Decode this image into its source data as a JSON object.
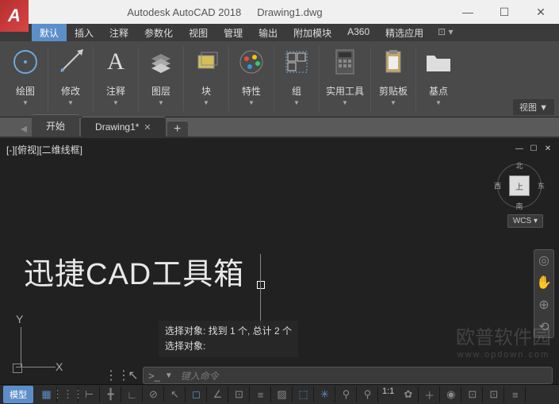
{
  "title": {
    "app": "Autodesk AutoCAD 2018",
    "file": "Drawing1.dwg"
  },
  "logo": "A",
  "win": {
    "min": "—",
    "max": "☐",
    "close": "✕"
  },
  "menu": [
    "默认",
    "插入",
    "注释",
    "参数化",
    "视图",
    "管理",
    "输出",
    "附加模块",
    "A360",
    "精选应用"
  ],
  "ribbon": [
    {
      "label": "绘图",
      "icon": "circle"
    },
    {
      "label": "修改",
      "icon": "move"
    },
    {
      "label": "注释",
      "icon": "text"
    },
    {
      "label": "图层",
      "icon": "layers"
    },
    {
      "label": "块",
      "icon": "block"
    },
    {
      "label": "特性",
      "icon": "palette"
    },
    {
      "label": "组",
      "icon": "group"
    },
    {
      "label": "实用工具",
      "icon": "calc"
    },
    {
      "label": "剪贴板",
      "icon": "clipboard"
    },
    {
      "label": "基点",
      "icon": "folder"
    }
  ],
  "ribbon_view": "视图 ▼",
  "tabs": [
    {
      "label": "开始",
      "closable": false
    },
    {
      "label": "Drawing1*",
      "closable": true
    }
  ],
  "tab_add": "+",
  "viewport": {
    "label": "[-][俯视][二维线框]",
    "cube_face": "上",
    "cube_dirs": {
      "n": "北",
      "s": "南",
      "e": "东",
      "w": "西"
    },
    "wcs": "WCS ▾",
    "canvas_text": "迅捷CAD工具箱",
    "feedback_line1": "选择对象: 找到 1 个, 总计 2 个",
    "feedback_line2": "选择对象:",
    "ucs": {
      "x": "X",
      "y": "Y"
    }
  },
  "cmdline": {
    "prompt": ">_",
    "placeholder": "键入命令"
  },
  "status": {
    "model": "模型",
    "scale": "1:1",
    "icons": [
      "▦",
      "▦",
      "⊢",
      "◉",
      "∟",
      "✂",
      "⊡",
      "∠",
      "▭",
      "◈",
      "⊞"
    ]
  },
  "watermark": {
    "main": "欧普软件园",
    "sub": "www.opdown.com"
  }
}
